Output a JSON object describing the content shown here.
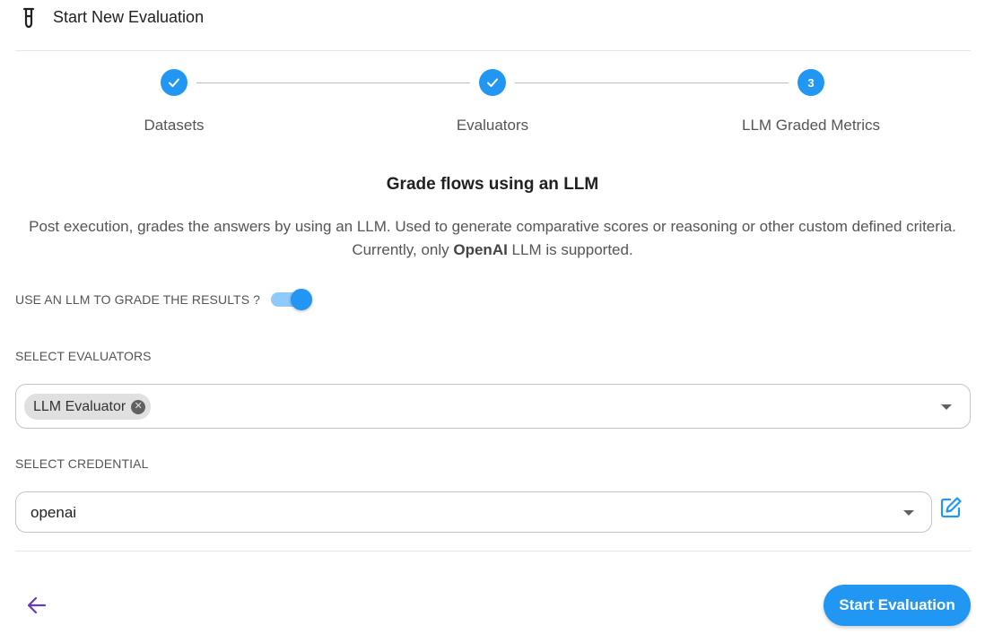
{
  "header": {
    "title": "Start New Evaluation",
    "icon": "flask-icon"
  },
  "stepper": {
    "steps": [
      {
        "label": "Datasets",
        "state": "completed"
      },
      {
        "label": "Evaluators",
        "state": "completed"
      },
      {
        "label": "LLM Graded Metrics",
        "state": "active",
        "number": "3"
      }
    ]
  },
  "section": {
    "title": "Grade flows using an LLM",
    "description_line1": "Post execution, grades the answers by using an LLM. Used to generate comparative scores or reasoning or other custom defined criteria.",
    "description_prefix": "Currently, only ",
    "description_bold": "OpenAI",
    "description_suffix": " LLM is supported."
  },
  "toggle": {
    "label": "USE AN LLM TO GRADE THE RESULTS ?",
    "checked": true
  },
  "evaluators": {
    "label": "SELECT EVALUATORS",
    "chips": [
      "LLM Evaluator"
    ]
  },
  "credential": {
    "label": "SELECT CREDENTIAL",
    "value": "openai"
  },
  "footer": {
    "start_label": "Start Evaluation"
  },
  "colors": {
    "accent": "#2196f3",
    "accent_light": "#90caf9",
    "back_arrow": "#673ab7"
  }
}
